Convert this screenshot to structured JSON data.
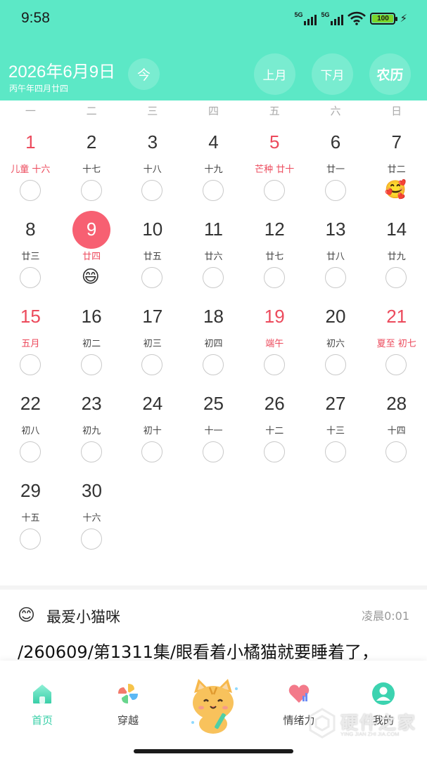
{
  "status_bar": {
    "time": "9:58",
    "signal1_label": "5G",
    "signal2_label": "5G",
    "battery": "100"
  },
  "header": {
    "date_title": "2026年6月9日",
    "lunar_subtitle": "丙午年四月廿四",
    "today_button": "今",
    "prev_month_button": "上月",
    "next_month_button": "下月",
    "lunar_button": "农历"
  },
  "weekdays": [
    "一",
    "二",
    "三",
    "四",
    "五",
    "六",
    "日"
  ],
  "calendar": {
    "weeks": [
      [
        {
          "day": "1",
          "lunar": "儿童 十六",
          "red": true
        },
        {
          "day": "2",
          "lunar": "十七"
        },
        {
          "day": "3",
          "lunar": "十八"
        },
        {
          "day": "4",
          "lunar": "十九"
        },
        {
          "day": "5",
          "lunar": "芒种 廿十",
          "red": true
        },
        {
          "day": "6",
          "lunar": "廿一"
        },
        {
          "day": "7",
          "lunar": "廿二",
          "emoji": "🥰"
        }
      ],
      [
        {
          "day": "8",
          "lunar": "廿三"
        },
        {
          "day": "9",
          "lunar": "廿四",
          "today": true,
          "emoji": "😄"
        },
        {
          "day": "10",
          "lunar": "廿五"
        },
        {
          "day": "11",
          "lunar": "廿六"
        },
        {
          "day": "12",
          "lunar": "廿七"
        },
        {
          "day": "13",
          "lunar": "廿八"
        },
        {
          "day": "14",
          "lunar": "廿九"
        }
      ],
      [
        {
          "day": "15",
          "lunar": "五月",
          "red": true
        },
        {
          "day": "16",
          "lunar": "初二"
        },
        {
          "day": "17",
          "lunar": "初三"
        },
        {
          "day": "18",
          "lunar": "初四"
        },
        {
          "day": "19",
          "lunar": "端午",
          "red": true
        },
        {
          "day": "20",
          "lunar": "初六"
        },
        {
          "day": "21",
          "lunar": "夏至 初七",
          "red": true
        }
      ],
      [
        {
          "day": "22",
          "lunar": "初八"
        },
        {
          "day": "23",
          "lunar": "初九"
        },
        {
          "day": "24",
          "lunar": "初十"
        },
        {
          "day": "25",
          "lunar": "十一"
        },
        {
          "day": "26",
          "lunar": "十二"
        },
        {
          "day": "27",
          "lunar": "十三"
        },
        {
          "day": "28",
          "lunar": "十四"
        }
      ],
      [
        {
          "day": "29",
          "lunar": "十五"
        },
        {
          "day": "30",
          "lunar": "十六"
        }
      ]
    ]
  },
  "entry": {
    "face_emoji": "😊",
    "name": "最爱小猫咪",
    "time": "凌晨0:01",
    "text": "/260609/第1311集/眼看着小橘猫就要睡着了，"
  },
  "nav": {
    "home": "首页",
    "travel": "穿越",
    "mood": "情绪力",
    "mine": "我的"
  },
  "watermark": {
    "main": "硬件之家",
    "sub": "YING JIAN ZHI JIA.COM"
  },
  "colors": {
    "header_bg": "#5ce8c6",
    "accent_red": "#ec4a5c",
    "today_circle": "#f76072",
    "nav_active": "#37cfa7"
  }
}
